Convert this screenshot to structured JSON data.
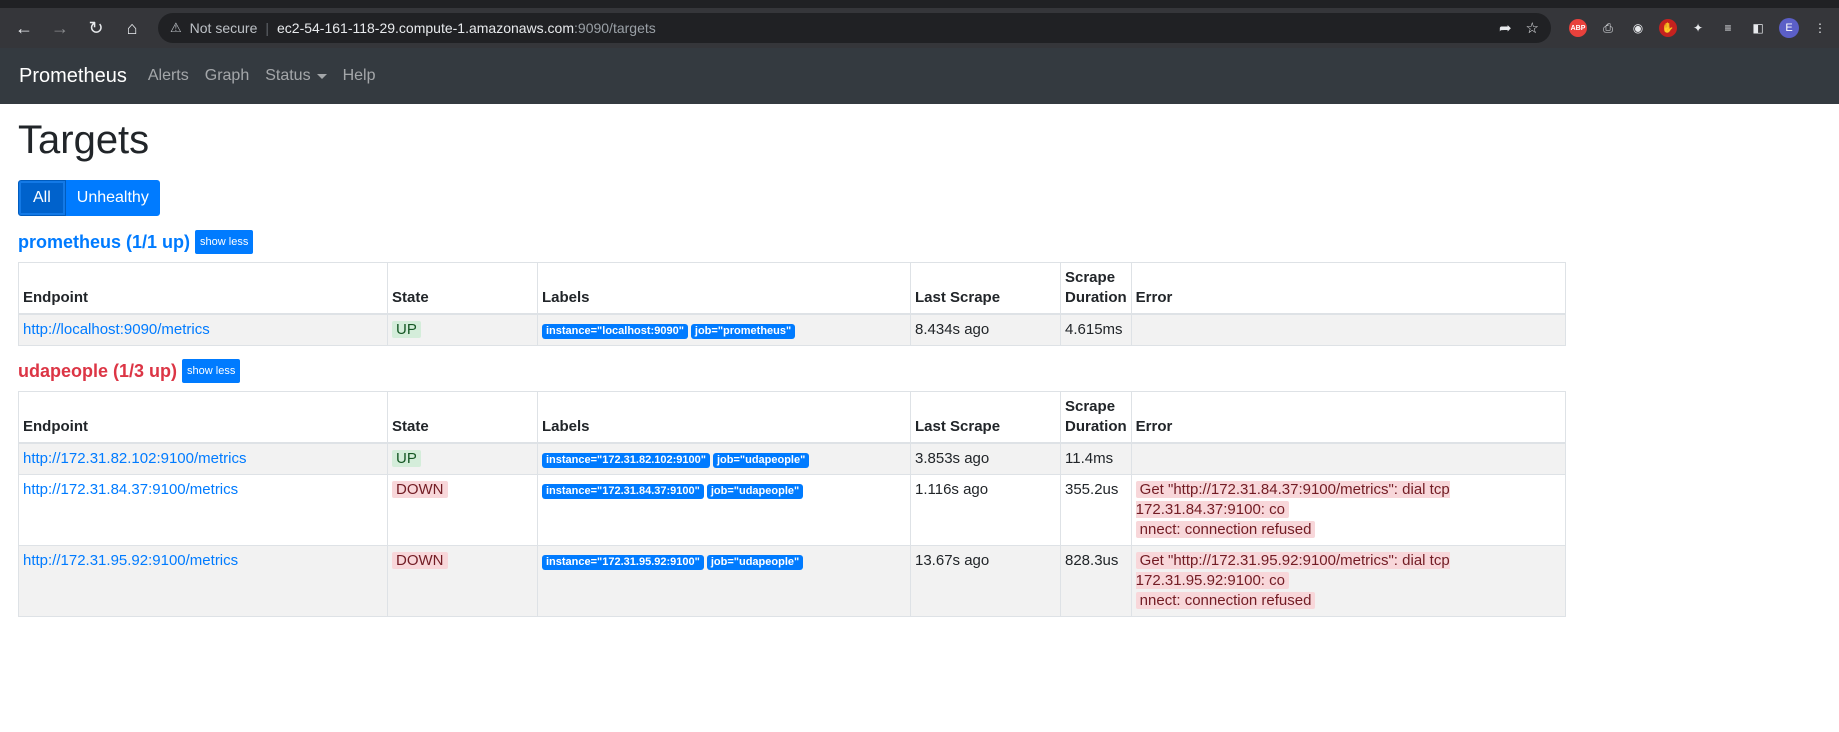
{
  "browser": {
    "security": "Not secure",
    "url_host": "ec2-54-161-118-29.compute-1.amazonaws.com",
    "url_path": ":9090/targets",
    "profile_initial": "E",
    "abp_label": "ABP"
  },
  "nav": {
    "brand": "Prometheus",
    "links": [
      "Alerts",
      "Graph",
      "Status",
      "Help"
    ]
  },
  "page": {
    "title": "Targets",
    "filters": [
      "All",
      "Unhealthy"
    ],
    "active_filter": "All"
  },
  "columns": [
    "Endpoint",
    "State",
    "Labels",
    "Last Scrape",
    "Scrape Duration",
    "Error"
  ],
  "jobs": [
    {
      "name": "prometheus (1/1 up)",
      "toggle": "show less",
      "healthy": true,
      "targets": [
        {
          "endpoint": "http://localhost:9090/metrics",
          "state": "UP",
          "labels": [
            "instance=\"localhost:9090\"",
            "job=\"prometheus\""
          ],
          "last_scrape": "8.434s ago",
          "duration": "4.615ms",
          "error": ""
        }
      ]
    },
    {
      "name": "udapeople (1/3 up)",
      "toggle": "show less",
      "healthy": false,
      "targets": [
        {
          "endpoint": "http://172.31.82.102:9100/metrics",
          "state": "UP",
          "labels": [
            "instance=\"172.31.82.102:9100\"",
            "job=\"udapeople\""
          ],
          "last_scrape": "3.853s ago",
          "duration": "11.4ms",
          "error": ""
        },
        {
          "endpoint": "http://172.31.84.37:9100/metrics",
          "state": "DOWN",
          "labels": [
            "instance=\"172.31.84.37:9100\"",
            "job=\"udapeople\""
          ],
          "last_scrape": "1.116s ago",
          "duration": "355.2us",
          "error_line1": "Get \"http://172.31.84.37:9100/metrics\": dial tcp 172.31.84.37:9100: co",
          "error_line2": "nnect: connection refused"
        },
        {
          "endpoint": "http://172.31.95.92:9100/metrics",
          "state": "DOWN",
          "labels": [
            "instance=\"172.31.95.92:9100\"",
            "job=\"udapeople\""
          ],
          "last_scrape": "13.67s ago",
          "duration": "828.3us",
          "error_line1": "Get \"http://172.31.95.92:9100/metrics\": dial tcp 172.31.95.92:9100: co",
          "error_line2": "nnect: connection refused"
        }
      ]
    }
  ]
}
